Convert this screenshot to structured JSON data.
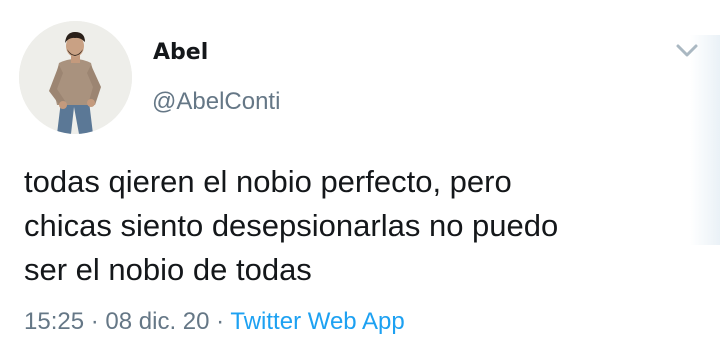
{
  "tweet": {
    "author_name": "Abel",
    "author_handle": "@AbelConti",
    "text_lines": [
      "todas qieren el nobio perfecto, pero",
      "chicas siento desepsionarlas no puedo",
      "ser el nobio de todas"
    ],
    "time": "15:25",
    "separator": "·",
    "date": "08 dic. 20",
    "source": "Twitter Web App"
  },
  "icons": {
    "menu": "chevron-down-icon",
    "avatar": "profile-photo"
  },
  "colors": {
    "text": "#14171a",
    "secondary": "#657786",
    "link": "#1da1f2",
    "background": "#ffffff"
  }
}
